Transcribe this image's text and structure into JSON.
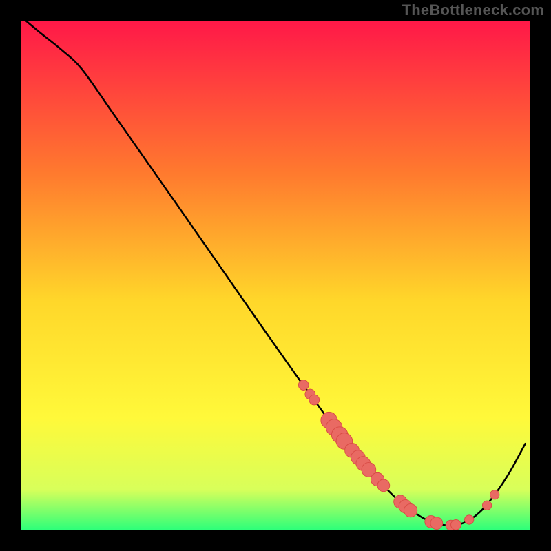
{
  "watermark": "TheBottleneck.com",
  "colors": {
    "background": "#000000",
    "curve": "#000000",
    "marker_fill": "#e96a63",
    "marker_stroke": "#d84a44",
    "gradient_top": "#ff1848",
    "gradient_mid1": "#ff7a2e",
    "gradient_mid2": "#ffd72a",
    "gradient_mid3": "#fff93a",
    "gradient_mid4": "#d8ff5a",
    "gradient_bottom": "#2bff7a"
  },
  "chart_data": {
    "type": "line",
    "title": "",
    "xlabel": "",
    "ylabel": "",
    "xlim": [
      0,
      100
    ],
    "ylim": [
      0,
      100
    ],
    "curve": {
      "x": [
        1,
        4,
        8,
        12,
        18,
        25,
        32,
        40,
        48,
        54,
        58,
        62,
        66,
        70,
        74,
        78,
        81,
        84,
        87,
        90,
        93,
        96,
        99
      ],
      "y": [
        100,
        97.5,
        94.3,
        90.5,
        82,
        72,
        62,
        50.5,
        39,
        30.5,
        25,
        19.5,
        14.5,
        10,
        6,
        3,
        1.5,
        1,
        1.5,
        3.5,
        7,
        11.5,
        17
      ]
    },
    "markers": [
      {
        "x": 55.5,
        "y": 28.5,
        "r": 1.0
      },
      {
        "x": 56.8,
        "y": 26.7,
        "r": 1.0
      },
      {
        "x": 57.6,
        "y": 25.6,
        "r": 1.0
      },
      {
        "x": 60.5,
        "y": 21.6,
        "r": 1.6
      },
      {
        "x": 61.5,
        "y": 20.2,
        "r": 1.6
      },
      {
        "x": 62.6,
        "y": 18.7,
        "r": 1.6
      },
      {
        "x": 63.5,
        "y": 17.5,
        "r": 1.6
      },
      {
        "x": 65.0,
        "y": 15.7,
        "r": 1.4
      },
      {
        "x": 66.2,
        "y": 14.3,
        "r": 1.4
      },
      {
        "x": 67.2,
        "y": 13.1,
        "r": 1.4
      },
      {
        "x": 68.3,
        "y": 11.9,
        "r": 1.4
      },
      {
        "x": 70.0,
        "y": 10.0,
        "r": 1.3
      },
      {
        "x": 71.2,
        "y": 8.8,
        "r": 1.2
      },
      {
        "x": 74.5,
        "y": 5.6,
        "r": 1.3
      },
      {
        "x": 75.5,
        "y": 4.7,
        "r": 1.3
      },
      {
        "x": 76.5,
        "y": 3.9,
        "r": 1.3
      },
      {
        "x": 80.5,
        "y": 1.7,
        "r": 1.2
      },
      {
        "x": 81.6,
        "y": 1.4,
        "r": 1.2
      },
      {
        "x": 84.4,
        "y": 1.0,
        "r": 1.0
      },
      {
        "x": 85.4,
        "y": 1.1,
        "r": 1.0
      },
      {
        "x": 88.0,
        "y": 2.1,
        "r": 0.9
      },
      {
        "x": 91.5,
        "y": 4.9,
        "r": 0.9
      },
      {
        "x": 93.0,
        "y": 7.0,
        "r": 0.9
      }
    ]
  }
}
